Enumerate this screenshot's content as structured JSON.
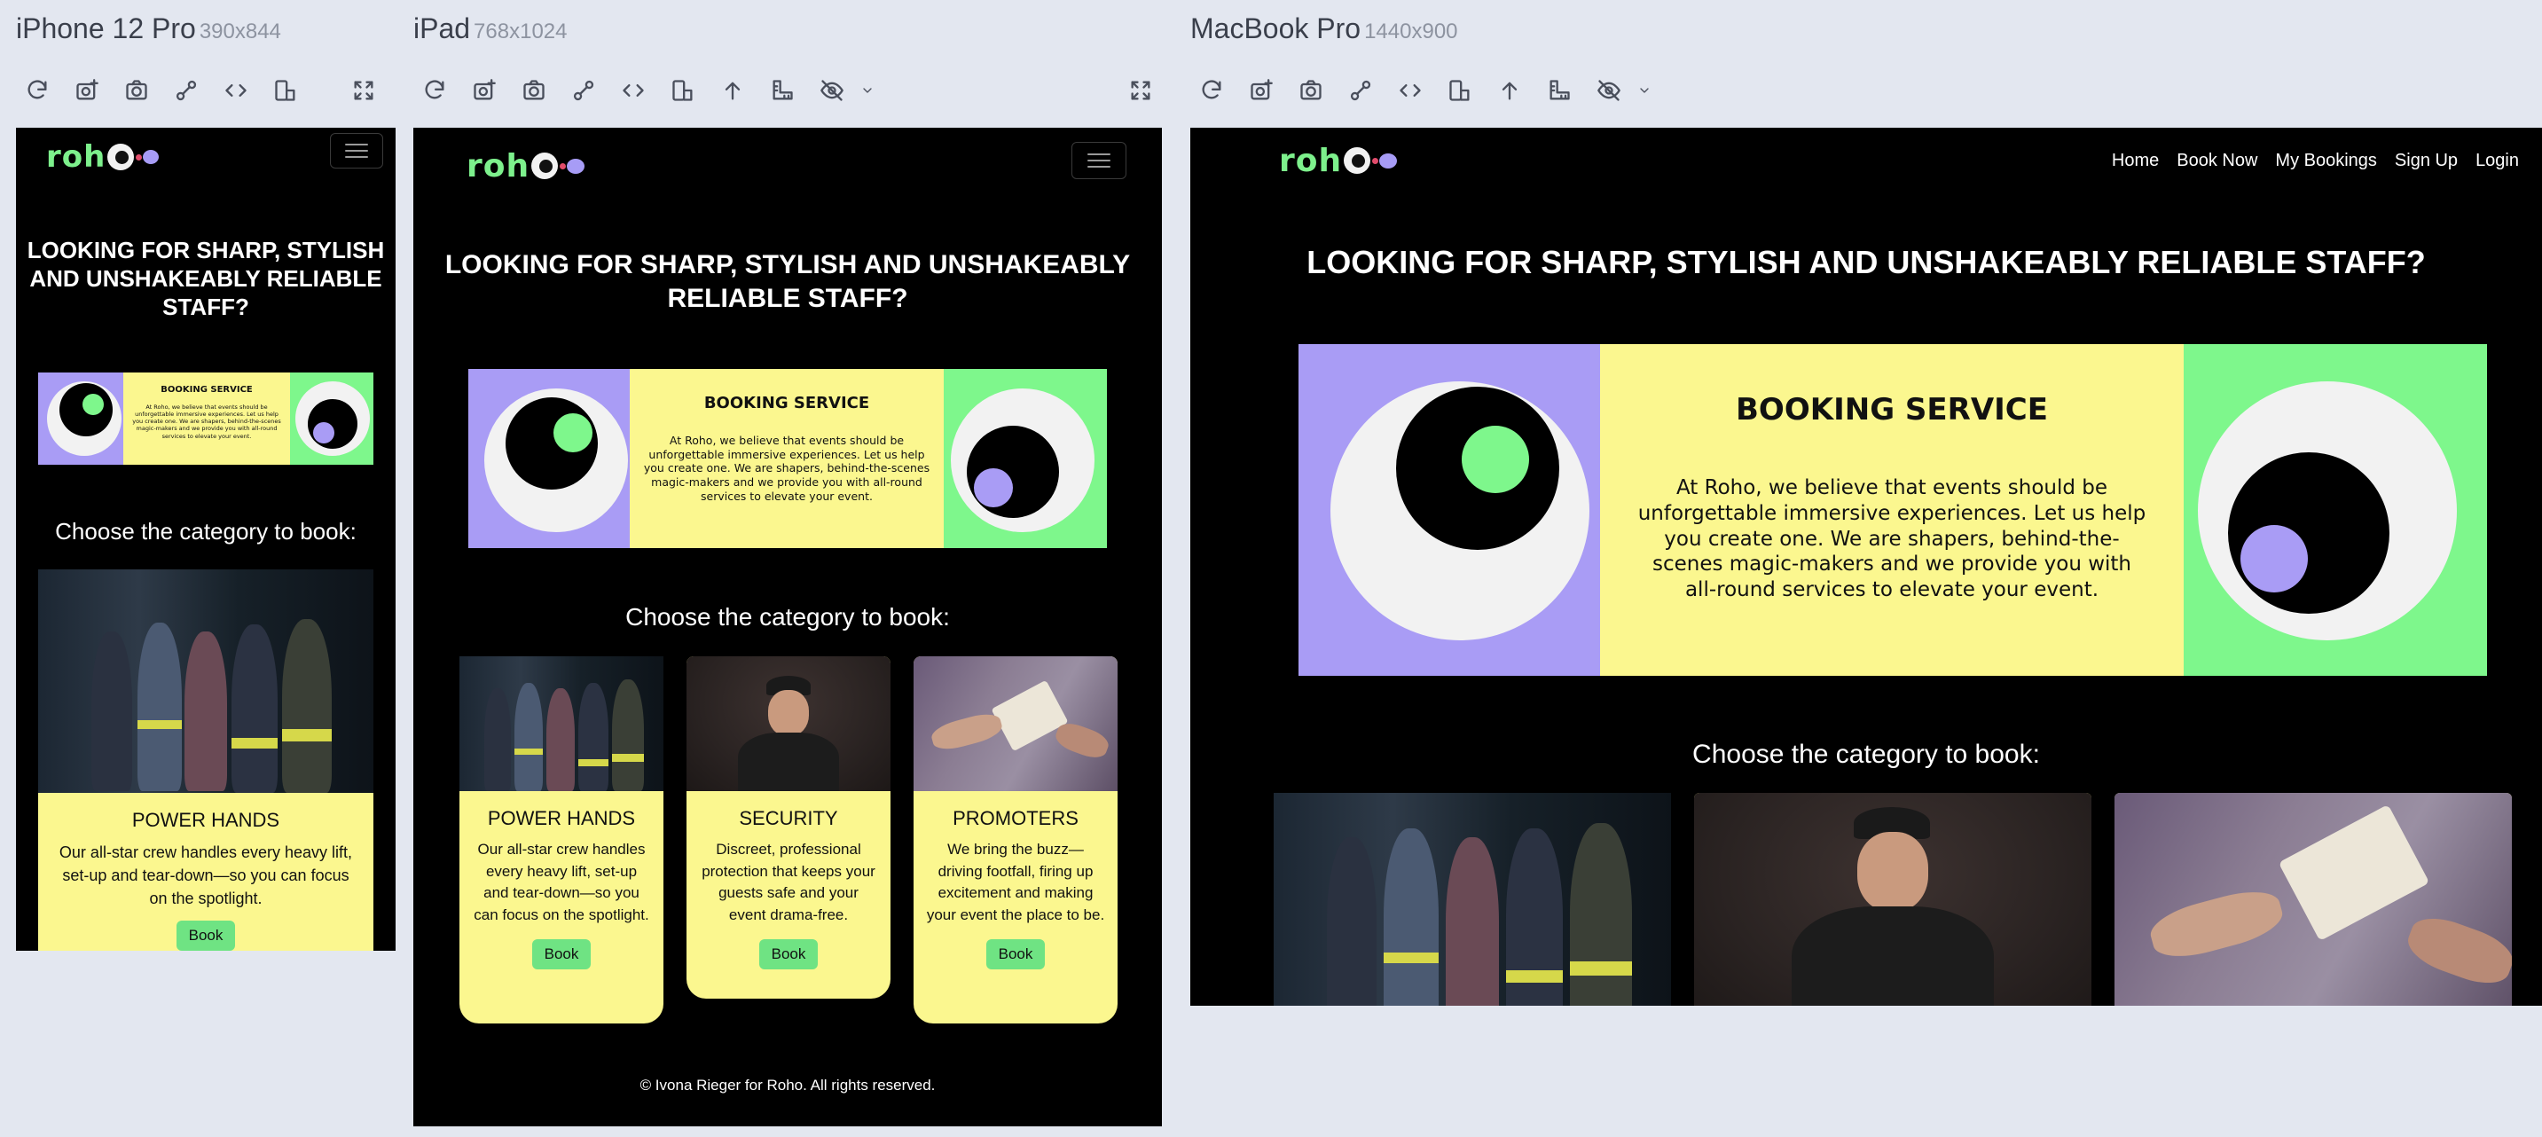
{
  "devices": [
    {
      "name": "iPhone 12 Pro",
      "dims": "390x844"
    },
    {
      "name": "iPad",
      "dims": "768x1024"
    },
    {
      "name": "MacBook Pro",
      "dims": "1440x900"
    }
  ],
  "toolbar": {
    "icons": [
      "refresh-icon",
      "screenshot-icon",
      "camera-icon",
      "link-icon",
      "code-icon",
      "rotate-icon",
      "scroll-up-icon",
      "ruler-icon",
      "hide-icon",
      "chevron-down-icon",
      "fullscreen-icon"
    ]
  },
  "site": {
    "logo": "roh",
    "nav": [
      "Home",
      "Book Now",
      "My Bookings",
      "Sign Up",
      "Login"
    ],
    "headline": "LOOKING FOR SHARP, STYLISH AND UNSHAKEABLY RELIABLE STAFF?",
    "banner": {
      "title": "BOOKING SERVICE",
      "text": "At Roho, we believe that events should be unforgettable immersive experiences. Let us help you create one. We are shapers, behind-the-scenes magic-makers and we provide you with all-round services to elevate your event."
    },
    "choose": "Choose the category to book:",
    "cards": [
      {
        "title": "POWER HANDS",
        "desc": "Our all-star crew handles every heavy lift, set-up and tear-down—so you can focus on the spotlight.",
        "button": "Book"
      },
      {
        "title": "SECURITY",
        "desc": "Discreet, professional protection that keeps your guests safe and your event drama-free.",
        "button": "Book"
      },
      {
        "title": "PROMOTERS",
        "desc": "We bring the buzz—driving footfall, firing up excitement and making your event the place to be.",
        "button": "Book"
      }
    ],
    "footer": "© Ivona Rieger for Roho. All rights reserved."
  },
  "colors": {
    "purple": "#a99cf5",
    "yellow": "#fbf78f",
    "green": "#7ef78c",
    "button": "#6fe383",
    "background": "#000000"
  }
}
